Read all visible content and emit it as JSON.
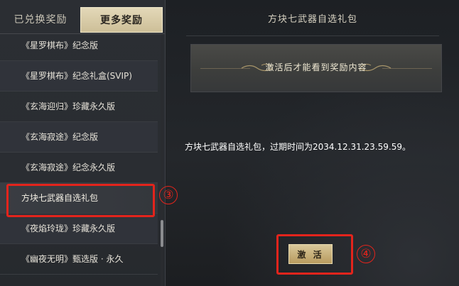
{
  "tabs": {
    "redeemed": "已兑换奖励",
    "more": "更多奖励"
  },
  "reward_list": [
    {
      "label": "《星罗棋布》纪念版"
    },
    {
      "label": "《星罗棋布》纪念礼盒(SVIP)"
    },
    {
      "label": "《玄海迎归》珍藏永久版"
    },
    {
      "label": "《玄海寂途》纪念版"
    },
    {
      "label": "《玄海寂途》纪念永久版"
    },
    {
      "label": "方块七武器自选礼包"
    },
    {
      "label": "《夜焰玲珑》珍藏永久版"
    },
    {
      "label": "《幽夜无明》甄选版 · 永久"
    }
  ],
  "selected_index": 5,
  "detail": {
    "title": "方块七武器自选礼包",
    "notice": "激活后才能看到奖励内容",
    "expire_text": "方块七武器自选礼包，过期时间为2034.12.31.23.59.59。",
    "activate_label": "激 活"
  },
  "annotations": {
    "step_3": "③",
    "step_4": "④",
    "color": "#e3241c"
  },
  "colors": {
    "tab_active": "#d8cba7",
    "button_gold": "#c8b07a"
  }
}
